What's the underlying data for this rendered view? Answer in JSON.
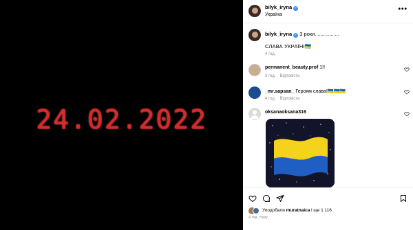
{
  "media": {
    "date_text": "24.02.2022"
  },
  "header": {
    "username": "bilyk_iryna",
    "location": "Україна",
    "verified_mark": "✓",
    "more": "•••"
  },
  "caption": {
    "username": "bilyk_iryna",
    "time_ago": "3 роки",
    "dots": ".................",
    "text": "СЛАВА УКРАЇНІ🇺🇦",
    "posted": "4 год."
  },
  "comments": [
    {
      "username": "permanent_beauty.prof",
      "text": "1!!",
      "time": "3 год.",
      "reply_label": "Відповісти"
    },
    {
      "username": "_mr.sapsan_",
      "text": "Героям слава!🇺🇦🇺🇦🇺🇦",
      "time": "4 год.",
      "reply_label": "Відповісти"
    },
    {
      "username": "oksanaoksana316",
      "text": ""
    }
  ],
  "likes": {
    "prefix": "Уподобали",
    "user": "muratnaica",
    "suffix": "і ще 1 116"
  },
  "post_time": "4 год. тому",
  "colors": {
    "accent_verified": "#3897f0",
    "date_red": "#d72a2a",
    "flag_blue": "#1f5fc4",
    "flag_yellow": "#f4d21e"
  },
  "icons": [
    "verified-icon",
    "more-icon",
    "heart-icon",
    "comment-icon",
    "share-icon",
    "bookmark-icon",
    "default-avatar-icon"
  ]
}
